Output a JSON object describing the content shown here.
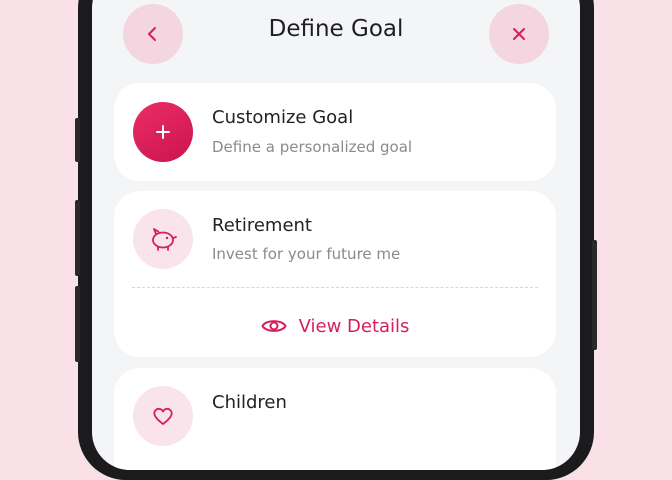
{
  "header": {
    "title": "Define Goal",
    "back_icon": "chevron-left-icon",
    "close_icon": "close-icon"
  },
  "goals": [
    {
      "title": "Customize Goal",
      "subtitle": "Define a personalized goal",
      "icon": "plus-icon"
    },
    {
      "title": "Retirement",
      "subtitle": "Invest for your future me",
      "icon": "piggy-bank-icon",
      "action_label": "View Details",
      "action_icon": "eye-icon"
    },
    {
      "title": "Children",
      "icon": "heart-icon"
    }
  ],
  "colors": {
    "accent": "#d61f58",
    "background": "#f9e1e7",
    "screen": "#f4f5f7",
    "card": "#ffffff"
  }
}
